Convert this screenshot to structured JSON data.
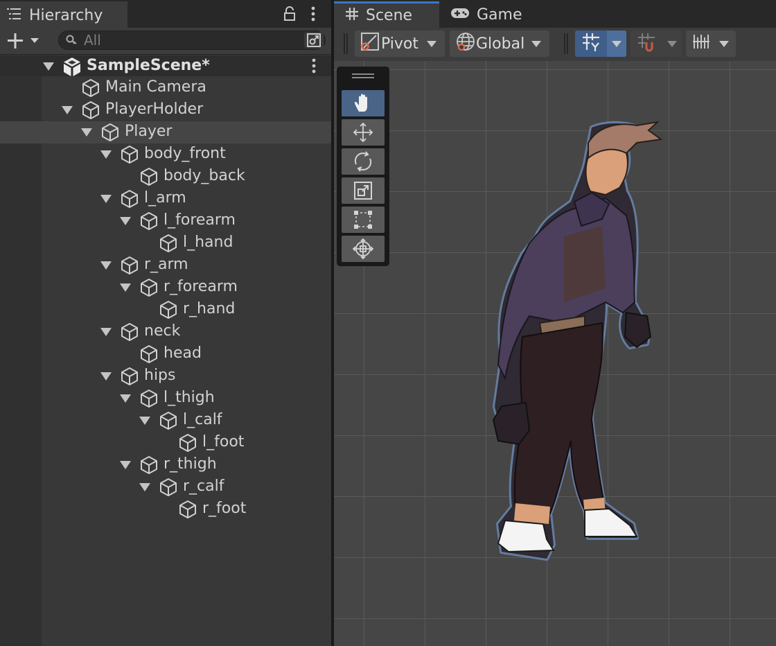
{
  "hierarchy": {
    "tab_label": "Hierarchy",
    "search_placeholder": "All",
    "rows": [
      {
        "label": "SampleScene*",
        "depth": 0,
        "expander": true,
        "kind": "scene"
      },
      {
        "label": "Main Camera",
        "depth": 1,
        "expander": false,
        "kind": "object"
      },
      {
        "label": "PlayerHolder",
        "depth": 1,
        "expander": true,
        "kind": "object"
      },
      {
        "label": "Player",
        "depth": 2,
        "expander": true,
        "kind": "object",
        "selected": true
      },
      {
        "label": "body_front",
        "depth": 3,
        "expander": true,
        "kind": "object"
      },
      {
        "label": "body_back",
        "depth": 4,
        "expander": false,
        "kind": "object"
      },
      {
        "label": "l_arm",
        "depth": 3,
        "expander": true,
        "kind": "object"
      },
      {
        "label": "l_forearm",
        "depth": 4,
        "expander": true,
        "kind": "object"
      },
      {
        "label": "l_hand",
        "depth": 5,
        "expander": false,
        "kind": "object"
      },
      {
        "label": "r_arm",
        "depth": 3,
        "expander": true,
        "kind": "object"
      },
      {
        "label": "r_forearm",
        "depth": 4,
        "expander": true,
        "kind": "object"
      },
      {
        "label": "r_hand",
        "depth": 5,
        "expander": false,
        "kind": "object"
      },
      {
        "label": "neck",
        "depth": 3,
        "expander": true,
        "kind": "object"
      },
      {
        "label": "head",
        "depth": 4,
        "expander": false,
        "kind": "object"
      },
      {
        "label": "hips",
        "depth": 3,
        "expander": true,
        "kind": "object"
      },
      {
        "label": "l_thigh",
        "depth": 4,
        "expander": true,
        "kind": "object"
      },
      {
        "label": "l_calf",
        "depth": 5,
        "expander": true,
        "kind": "object"
      },
      {
        "label": "l_foot",
        "depth": 6,
        "expander": false,
        "kind": "object"
      },
      {
        "label": "r_thigh",
        "depth": 4,
        "expander": true,
        "kind": "object"
      },
      {
        "label": "r_calf",
        "depth": 5,
        "expander": true,
        "kind": "object"
      },
      {
        "label": "r_foot",
        "depth": 6,
        "expander": false,
        "kind": "object"
      }
    ]
  },
  "scene_view": {
    "tabs": [
      {
        "label": "Scene",
        "icon": "grid-hash-icon",
        "active": true
      },
      {
        "label": "Game",
        "icon": "gamepad-icon",
        "active": false
      }
    ],
    "pivot_label": "Pivot",
    "global_label": "Global",
    "tools": [
      "hand-tool-icon",
      "move-tool-icon",
      "rotate-tool-icon",
      "scale-tool-icon",
      "rect-tool-icon",
      "transform-tool-icon"
    ],
    "active_tool": "hand-tool-icon"
  },
  "colors": {
    "accent_blue": "#4a6487",
    "panel_bg": "#383838",
    "selected_row": "#454545"
  }
}
